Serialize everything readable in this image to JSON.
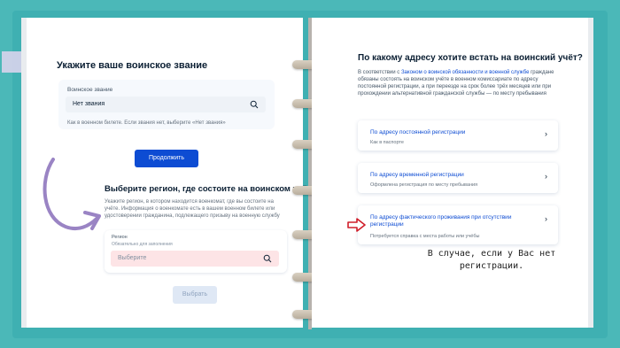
{
  "left": {
    "rank_title": "Укажите ваше воинское звание",
    "rank_field_label": "Воинское звание",
    "rank_field_value": "Нет звания",
    "rank_hint": "Как в военном билете. Если звания нет, выберите «Нет звания»",
    "continue_button": "Продолжить",
    "region_title": "Выберите регион, где состоите на воинском учёте",
    "region_desc": "Укажите регион, в котором находится военкомат, где вы состоите на учёте. Информация о военкомате есть в вашем военном билете или удостоверении гражданина, подлежащего призыву на военную службу",
    "region_field_label": "Регион",
    "region_field_required": "Обязательно для заполнения",
    "region_placeholder": "Выберите",
    "select_button": "Выбрать"
  },
  "right": {
    "title": "По какому адресу хотите встать на воинский учёт?",
    "intro": "В соответствии с Законом о воинской обязанности и военной службе граждане обязаны состоять на воинском учёте в военном комиссариате по адресу постоянной регистрации, а при переезде на срок более трёх месяцев или при прохождении альтернативной гражданской службы — по месту пребывания",
    "intro_link": "Законом о воинской обязанности и военной службе",
    "options": [
      {
        "title": "По адресу постоянной регистрации",
        "sub": "Как в паспорте"
      },
      {
        "title": "По адресу временной регистрации",
        "sub": "Оформлена регистрация по месту пребывания"
      },
      {
        "title": "По адресу фактического проживания при отсутствии регистрации",
        "sub": "Потребуется справка с места работы или учёбы"
      }
    ]
  },
  "annotation": {
    "line1": "В случае, если у Вас нет",
    "line2": "регистрации."
  },
  "colors": {
    "accent": "#0d4cd3",
    "frame": "#3fb0b2",
    "arrow_purple": "#9a84c4",
    "arrow_red": "#d01e2a",
    "error_field": "#fde4e6"
  }
}
